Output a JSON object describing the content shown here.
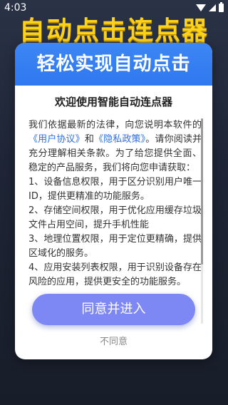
{
  "status_bar": {
    "time": "4:03",
    "icons": [
      "wifi-icon",
      "signal-icon",
      "battery-icon"
    ]
  },
  "app_title": "自动点击连点器",
  "dialog": {
    "header": "轻松实现自动点击",
    "title": "欢迎使用智能自动连点器",
    "intro_before_user_agreement": "我们依据最新的法律，向您说明本软件的",
    "user_agreement_link": "《用户协议》",
    "and": "和",
    "privacy_link": "《隐私政策》",
    "intro_after_privacy": "。请你阅读并充分理解相关条款。为了给您提供全面、稳定的产品服务，我们将向您申请获取：",
    "items": [
      "1、设备信息权限，用于区分识别用户唯一ID，提供更精准的功能服务。",
      "2、存储空间权限，用于优化应用缓存垃圾文件占用空间，提升手机性能",
      "3、地理位置权限，用于定位更精确，提供区域化的服务。",
      "4、应用安装列表权限，用于识别设备存在风险的应用，提供更安全的功能服务。"
    ],
    "agree_button": "同意并进入",
    "disagree_link": "不同意"
  },
  "colors": {
    "header_blue": "#3d86f5",
    "link_blue": "#2a6ee8",
    "agree_button": "#7e88f4",
    "app_title_yellow": "#ffd21a"
  }
}
